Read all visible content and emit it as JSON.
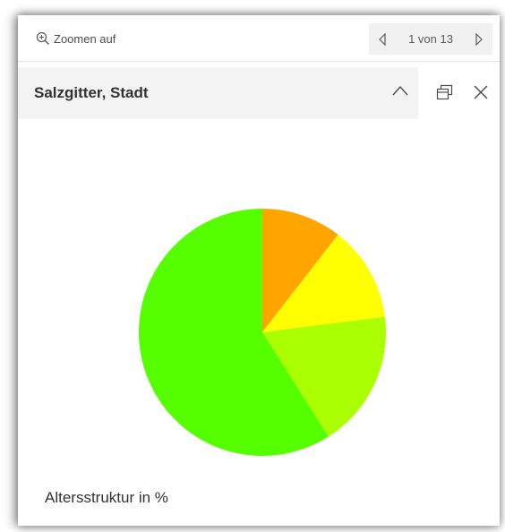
{
  "popup": {
    "zoom_label": "Zoomen auf",
    "pager_label": "1 von 13",
    "title": "Salzgitter, Stadt",
    "caption": "Altersstruktur in %"
  },
  "icons": {
    "zoom": "zoom-in-icon",
    "prev": "chevron-left-icon",
    "next": "chevron-right-icon",
    "collapse": "chevron-up-icon",
    "dock": "dock-icon",
    "close": "close-icon"
  },
  "chart_data": {
    "type": "pie",
    "title": "Altersstruktur in %",
    "start_angle_deg": 0,
    "direction": "clockwise",
    "slices": [
      {
        "value": 10.5,
        "color": "#FFA500"
      },
      {
        "value": 12.5,
        "color": "#FFFF00"
      },
      {
        "value": 18.0,
        "color": "#AAFF00"
      },
      {
        "value": 59.0,
        "color": "#55FF00"
      }
    ]
  }
}
